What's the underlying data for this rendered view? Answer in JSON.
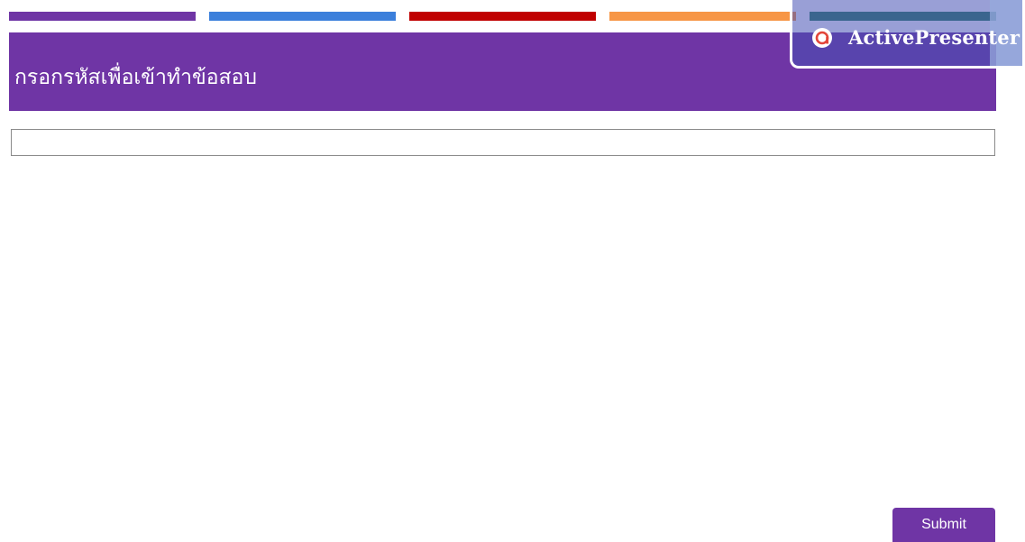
{
  "colors": {
    "stripes": [
      "#6f35a5",
      "#3b7fdb",
      "#c00000",
      "#f79646",
      "#2e7f5f"
    ],
    "title_bar": "#6f35a5",
    "submit_button": "#6f35a5",
    "watermark_logo": "#e2463a"
  },
  "header": {
    "title": "กรอกรหัสเพื่อเข้าทำข้อสอบ"
  },
  "form": {
    "password_value": "",
    "password_placeholder": "",
    "submit_label": "Submit"
  },
  "watermark": {
    "text": "ActivePresenter",
    "icon": "activepresenter-logo-icon"
  }
}
